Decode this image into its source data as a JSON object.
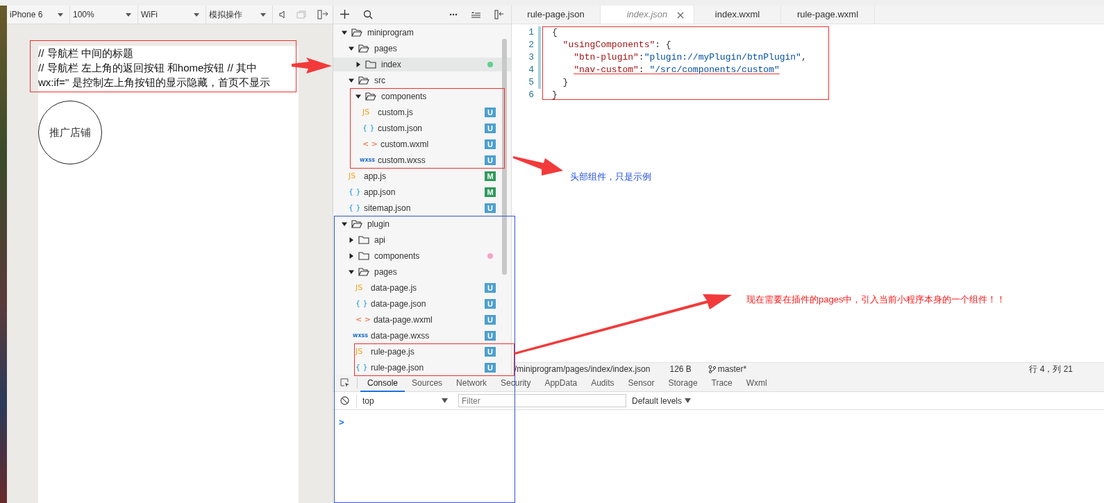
{
  "simulator": {
    "toolbar": [
      {
        "label": "iPhone 6"
      },
      {
        "label": "100%"
      },
      {
        "label": "WiFi"
      },
      {
        "label": "模拟操作"
      }
    ],
    "comment_lines": [
      "// 导航栏 中间的标题",
      "// 导航栏 左上角的返回按钮 和home按钮 // 其中",
      "wx:if='' 是控制左上角按钮的显示隐藏，首页不显示"
    ],
    "circle_label": "推广店铺"
  },
  "file_tree": [
    {
      "name": "miniprogram",
      "kind": "folder",
      "expanded": true,
      "selected": false,
      "children": [
        {
          "name": "pages",
          "kind": "folder",
          "expanded": true,
          "selected": false,
          "children": [
            {
              "name": "index",
              "kind": "folder",
              "expanded": false,
              "selected": true,
              "color": "#5fcf8f"
            }
          ]
        },
        {
          "name": "src",
          "kind": "folder",
          "expanded": true,
          "selected": false,
          "children": [
            {
              "name": "components",
              "kind": "folder",
              "expanded": true,
              "selected": false,
              "children": [
                {
                  "name": "custom.js",
                  "kind": "js",
                  "type_label": "JS",
                  "badge": "U",
                  "color": "#4d9fcc",
                  "selected": false
                },
                {
                  "name": "custom.json",
                  "kind": "json",
                  "type_label": "{ }",
                  "badge": "U",
                  "color": "#4d9fcc",
                  "selected": false
                },
                {
                  "name": "custom.wxml",
                  "kind": "wxml",
                  "type_label": "< >",
                  "badge": "U",
                  "color": "#4d9fcc",
                  "selected": false
                },
                {
                  "name": "custom.wxss",
                  "kind": "wxss",
                  "type_label": "wxss",
                  "badge": "U",
                  "color": "#4d9fcc",
                  "selected": false
                }
              ]
            }
          ]
        },
        {
          "name": "app.js",
          "kind": "js",
          "type_label": "JS",
          "badge": "M",
          "color": "#2f9a5c",
          "selected": false
        },
        {
          "name": "app.json",
          "kind": "json",
          "type_label": "{ }",
          "badge": "M",
          "color": "#2f9a5c",
          "selected": false
        },
        {
          "name": "sitemap.json",
          "kind": "json",
          "type_label": "{ }",
          "badge": "U",
          "color": "#4d9fcc",
          "selected": false
        }
      ]
    },
    {
      "name": "plugin",
      "kind": "folder",
      "expanded": true,
      "selected": false,
      "children": [
        {
          "name": "api",
          "kind": "folder",
          "expanded": false,
          "selected": false
        },
        {
          "name": "components",
          "kind": "folder",
          "expanded": false,
          "selected": false,
          "color": "#f5a3c7"
        },
        {
          "name": "pages",
          "kind": "folder",
          "expanded": true,
          "selected": false,
          "children": [
            {
              "name": "data-page.js",
              "kind": "js",
              "type_label": "JS",
              "badge": "U",
              "color": "#4d9fcc",
              "selected": false
            },
            {
              "name": "data-page.json",
              "kind": "json",
              "type_label": "{ }",
              "badge": "U",
              "color": "#4d9fcc",
              "selected": false
            },
            {
              "name": "data-page.wxml",
              "kind": "wxml",
              "type_label": "< >",
              "badge": "U",
              "color": "#4d9fcc",
              "selected": false
            },
            {
              "name": "data-page.wxss",
              "kind": "wxss",
              "type_label": "wxss",
              "badge": "U",
              "color": "#4d9fcc",
              "selected": false
            },
            {
              "name": "rule-page.js",
              "kind": "js",
              "type_label": "JS",
              "badge": "U",
              "color": "#4d9fcc",
              "selected": false
            },
            {
              "name": "rule-page.json",
              "kind": "json",
              "type_label": "{ }",
              "badge": "U",
              "color": "#4d9fcc",
              "selected": false
            }
          ]
        }
      ]
    }
  ],
  "editor": {
    "tabs": [
      {
        "label": "rule-page.json",
        "selected": false
      },
      {
        "label": "index.json",
        "selected": true
      },
      {
        "label": "index.wxml",
        "selected": false
      },
      {
        "label": "rule-page.wxml",
        "selected": false
      }
    ],
    "lines": [
      {
        "number": "1",
        "changed": true,
        "tokens": [
          {
            "kind": "punct",
            "text": "{"
          }
        ]
      },
      {
        "number": "2",
        "changed": true,
        "tokens": [
          {
            "kind": "key",
            "text": "  \"usingComponents\""
          },
          {
            "kind": "punct",
            "text": ": {"
          }
        ]
      },
      {
        "number": "3",
        "changed": true,
        "tokens": [
          {
            "kind": "key",
            "text": "    \"btn-plugin\""
          },
          {
            "kind": "punct",
            "text": ":"
          },
          {
            "kind": "string",
            "text": "\"plugin://myPlugin/btnPlugin\""
          },
          {
            "kind": "punct",
            "text": ","
          }
        ]
      },
      {
        "number": "4",
        "changed": true,
        "underlined": true,
        "tokens": [
          {
            "kind": "key",
            "text": "    \"nav-custom\""
          },
          {
            "kind": "punct",
            "text": ": "
          },
          {
            "kind": "string",
            "text": "\"/src/components/custom\""
          }
        ]
      },
      {
        "number": "5",
        "changed": true,
        "tokens": [
          {
            "kind": "punct",
            "text": "  }"
          }
        ]
      },
      {
        "number": "6",
        "changed": false,
        "tokens": [
          {
            "kind": "punct",
            "text": "}"
          }
        ]
      }
    ],
    "status_bar": {
      "path": "/miniprogram/pages/index/index.json",
      "size": "126 B",
      "branch": "master*",
      "position": "行 4，列 21"
    }
  },
  "devtools": {
    "tabs": [
      {
        "label": "Console",
        "selected": true
      },
      {
        "label": "Sources",
        "selected": false
      },
      {
        "label": "Network",
        "selected": false
      },
      {
        "label": "Security",
        "selected": false
      },
      {
        "label": "AppData",
        "selected": false
      },
      {
        "label": "Audits",
        "selected": false
      },
      {
        "label": "Sensor",
        "selected": false
      },
      {
        "label": "Storage",
        "selected": false
      },
      {
        "label": "Trace",
        "selected": false
      },
      {
        "label": "Wxml",
        "selected": false
      }
    ],
    "context": "top",
    "filter_placeholder": "Filter",
    "levels": "Default levels",
    "prompt": ">"
  },
  "annotations": [
    {
      "text": "头部组件，只是示例",
      "color": "#2350e0"
    },
    {
      "text": "现在需要在插件的pages中，引入当前小程序本身的一个组件！！",
      "color": "#ff1a1a"
    }
  ]
}
